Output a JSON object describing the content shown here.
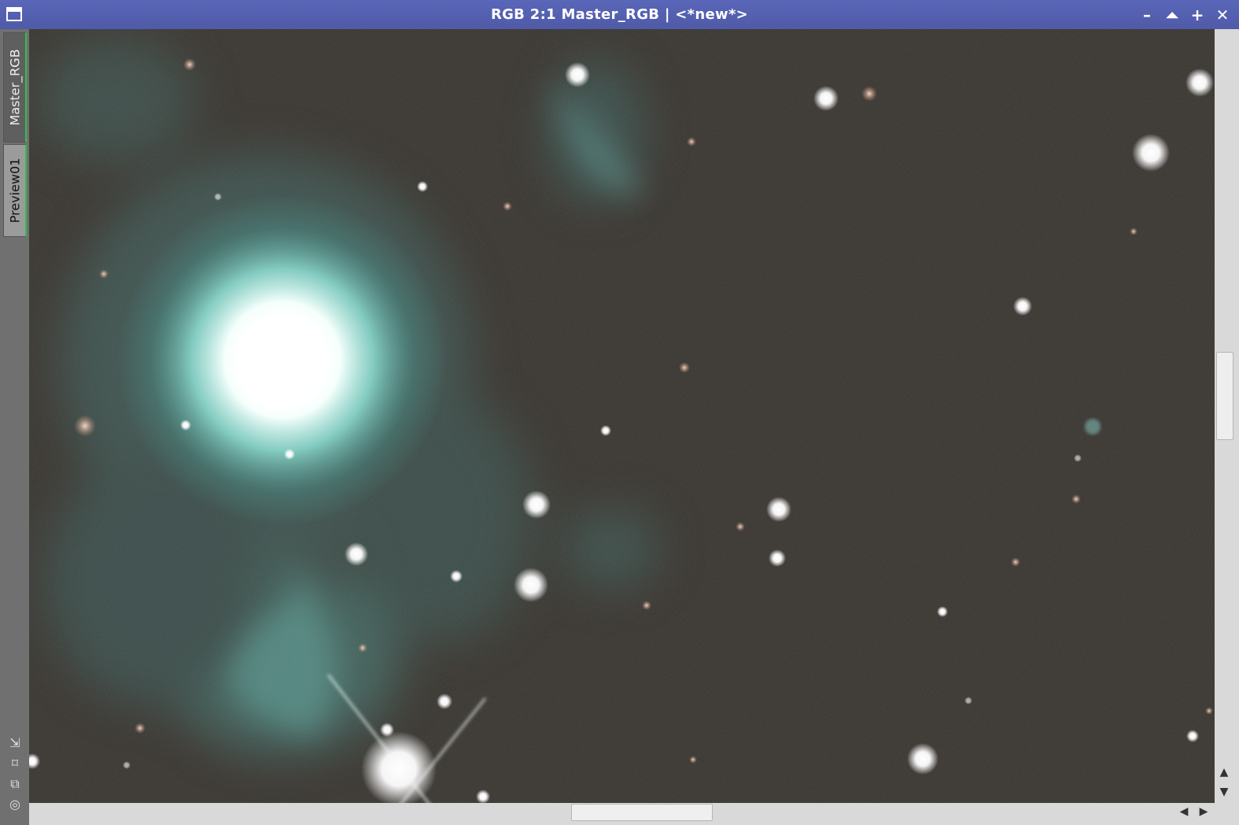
{
  "window": {
    "title": "RGB 2:1 Master_RGB | <*new*>",
    "controls": {
      "minimize": "–",
      "shade": "⏶",
      "maximize": "+",
      "close": "✕"
    }
  },
  "sidebar": {
    "tabs": [
      {
        "label": "Master_RGB"
      },
      {
        "label": "Preview01"
      }
    ],
    "tools": [
      "⇲",
      "⌑",
      "⧉",
      "◎"
    ]
  },
  "colors": {
    "titlebar": "#5560b0",
    "tab_accent": "#2fbf4f",
    "sky": "#35312c",
    "nebula": "#6ab8b0"
  },
  "scrollbars": {
    "vertical": {
      "up": "▲",
      "down": "▼"
    },
    "horizontal": {
      "left": "◀",
      "right": "▶"
    }
  }
}
